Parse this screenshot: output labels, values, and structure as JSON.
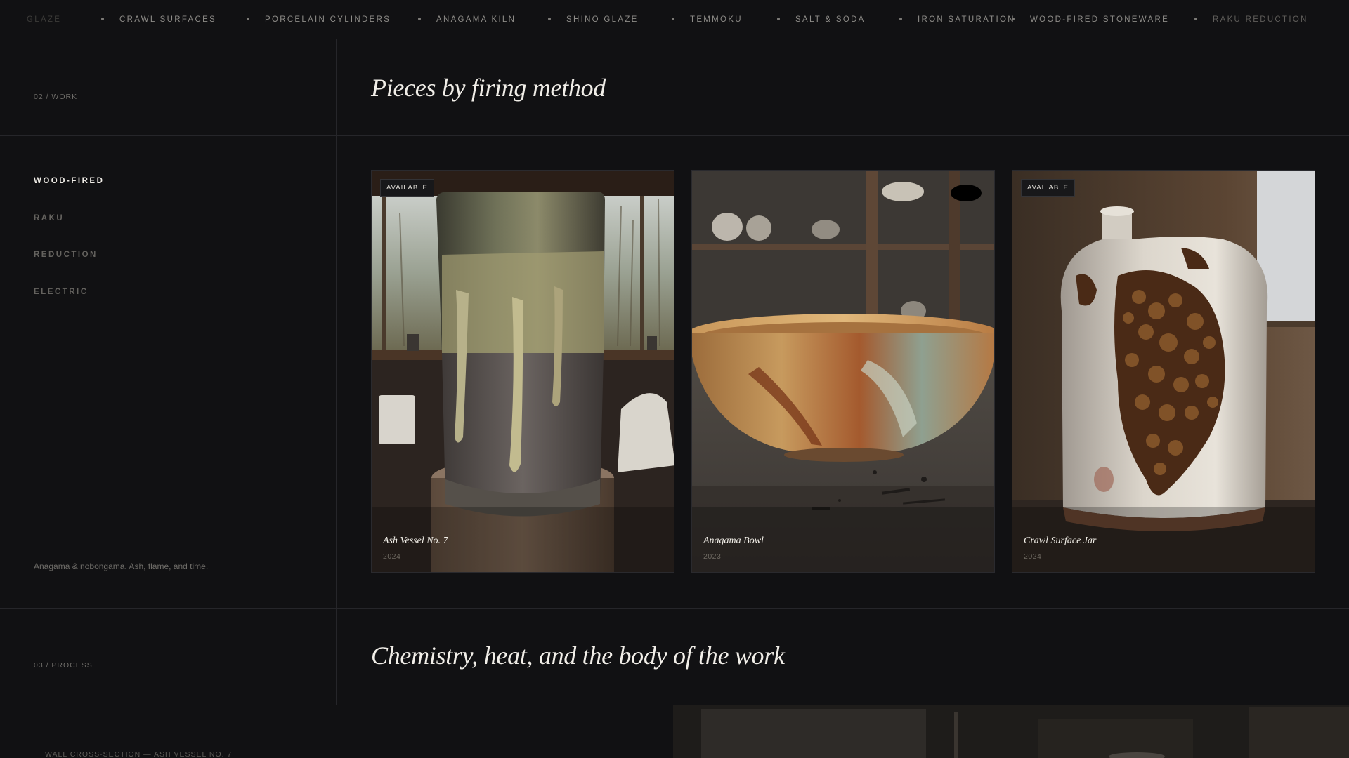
{
  "marquee": {
    "items": [
      "GLAZE",
      "CRAWL SURFACES",
      "PORCELAIN CYLINDERS",
      "ANAGAMA KILN",
      "SHINO GLAZE",
      "TEMMOKU",
      "SALT & SODA",
      "IRON SATURATION",
      "WOOD-FIRED STONEWARE",
      "RAKU REDUCTION"
    ]
  },
  "work": {
    "label": "02 / WORK",
    "title": "Pieces by firing method",
    "filters": [
      "WOOD-FIRED",
      "RAKU",
      "REDUCTION",
      "ELECTRIC"
    ],
    "active_filter": "WOOD-FIRED",
    "side_note": "Anagama & nobongama. Ash, flame, and time.",
    "cards": [
      {
        "title": "Ash Vessel No. 7",
        "year": "2024",
        "badge": "AVAILABLE"
      },
      {
        "title": "Anagama Bowl",
        "year": "2023",
        "badge": ""
      },
      {
        "title": "Crawl Surface Jar",
        "year": "2024",
        "badge": "AVAILABLE"
      }
    ]
  },
  "process": {
    "label": "03 / PROCESS",
    "title": "Chemistry, heat, and the body of the work",
    "caption": "WALL CROSS-SECTION — ASH VESSEL NO. 7"
  },
  "colors": {
    "background": "#111113",
    "text": "#e9e6e0",
    "muted": "#6e6c68",
    "divider": "#26262a"
  }
}
